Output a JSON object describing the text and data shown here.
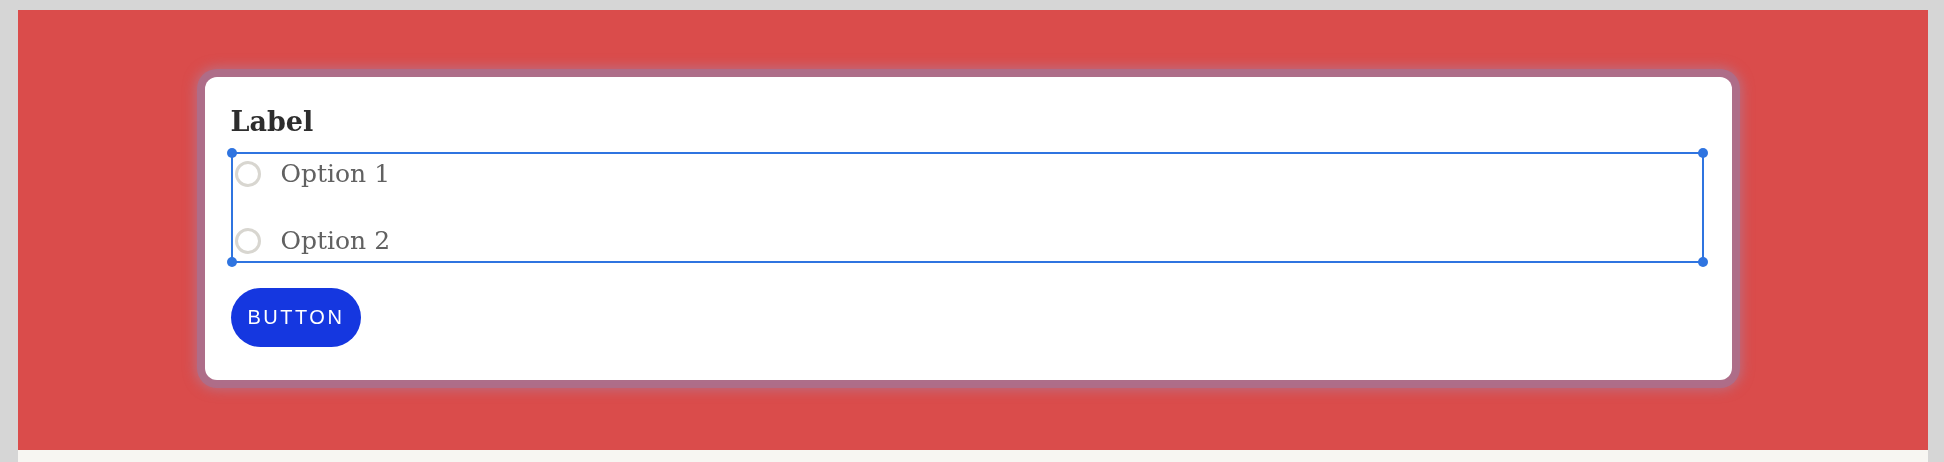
{
  "form": {
    "label": "Label",
    "options": [
      {
        "label": "Option 1",
        "selected": false
      },
      {
        "label": "Option 2",
        "selected": false
      }
    ],
    "button": "BUTTON"
  }
}
